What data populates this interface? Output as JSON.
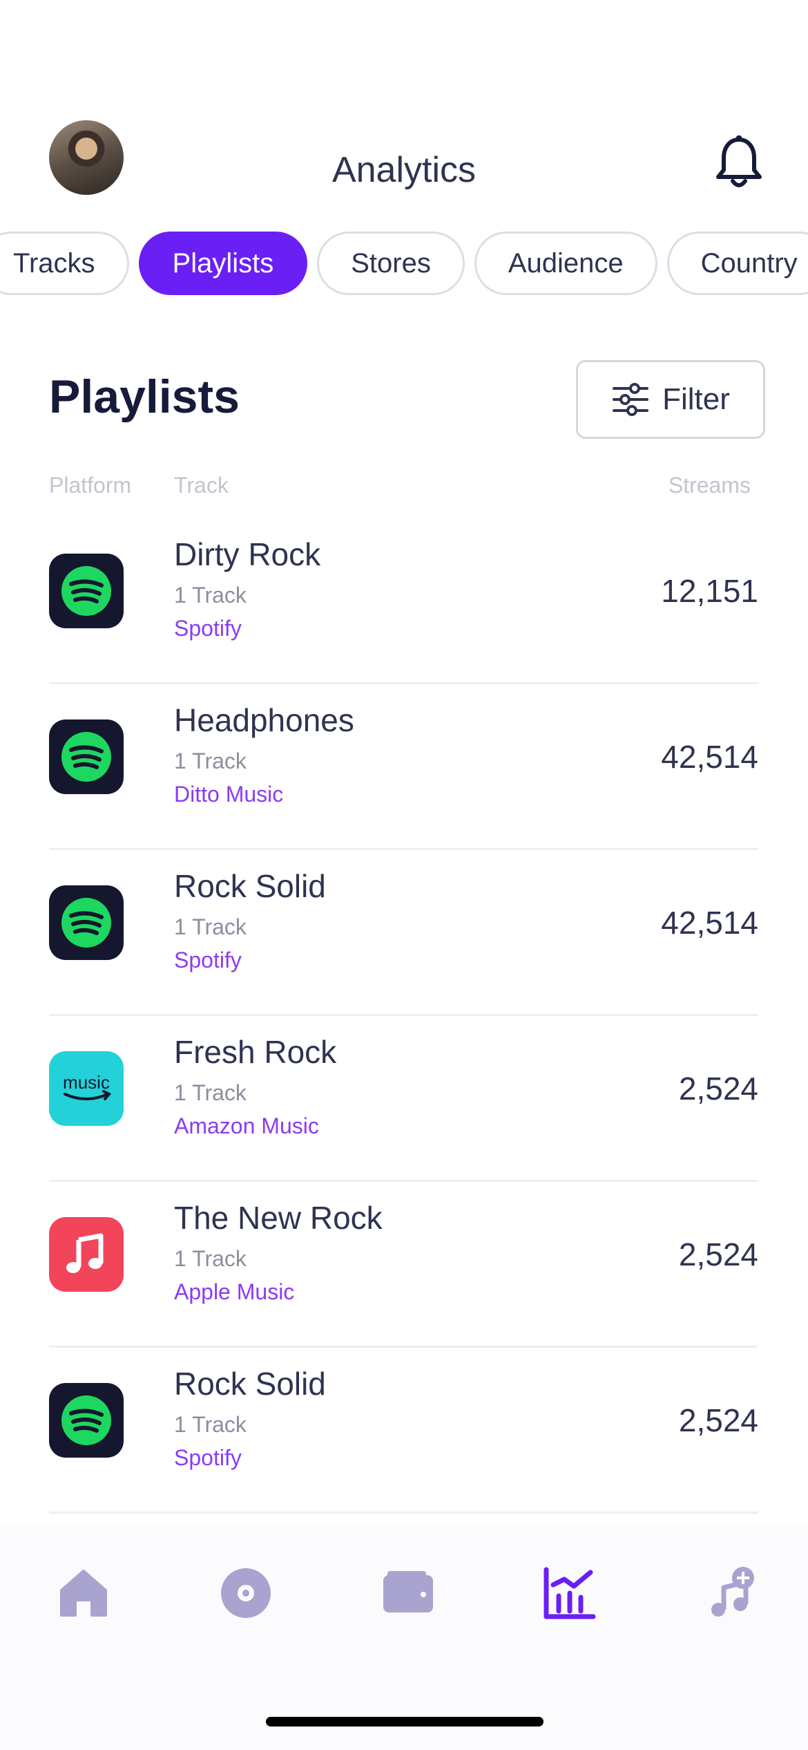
{
  "header": {
    "title": "Analytics",
    "avatar_icon": "user-avatar",
    "bell_icon": "bell-icon"
  },
  "tabs": [
    {
      "label": "Tracks",
      "active": false
    },
    {
      "label": "Playlists",
      "active": true
    },
    {
      "label": "Stores",
      "active": false
    },
    {
      "label": "Audience",
      "active": false
    },
    {
      "label": "Country",
      "active": false
    }
  ],
  "section": {
    "title": "Playlists",
    "filter_label": "Filter"
  },
  "columns": {
    "platform": "Platform",
    "track": "Track",
    "streams": "Streams"
  },
  "rows": [
    {
      "name": "Dirty Rock",
      "tracks": "1 Track",
      "store": "Spotify",
      "streams": "12,151",
      "platform": "spotify"
    },
    {
      "name": "Headphones",
      "tracks": "1 Track",
      "store": "Ditto Music",
      "streams": "42,514",
      "platform": "spotify"
    },
    {
      "name": "Rock Solid",
      "tracks": "1 Track",
      "store": "Spotify",
      "streams": "42,514",
      "platform": "spotify"
    },
    {
      "name": "Fresh Rock",
      "tracks": "1 Track",
      "store": "Amazon Music",
      "streams": "2,524",
      "platform": "amazon"
    },
    {
      "name": "The New Rock",
      "tracks": "1 Track",
      "store": "Apple Music",
      "streams": "2,524",
      "platform": "apple"
    },
    {
      "name": "Rock Solid",
      "tracks": "1 Track",
      "store": "Spotify",
      "streams": "2,524",
      "platform": "spotify"
    }
  ],
  "amazon_logo_text": "music",
  "nav": [
    {
      "icon": "home-icon",
      "active": false
    },
    {
      "icon": "disc-icon",
      "active": false
    },
    {
      "icon": "wallet-icon",
      "active": false
    },
    {
      "icon": "analytics-icon",
      "active": true
    },
    {
      "icon": "add-music-icon",
      "active": false
    }
  ],
  "colors": {
    "accent": "#6a1ff5",
    "store_text": "#8b3bf3",
    "nav_inactive": "#a9a3cf",
    "spotify_green": "#1ed760",
    "spotify_bg": "#14172e",
    "amazon_bg": "#23d1d8",
    "apple_bg": "#f2455a"
  }
}
